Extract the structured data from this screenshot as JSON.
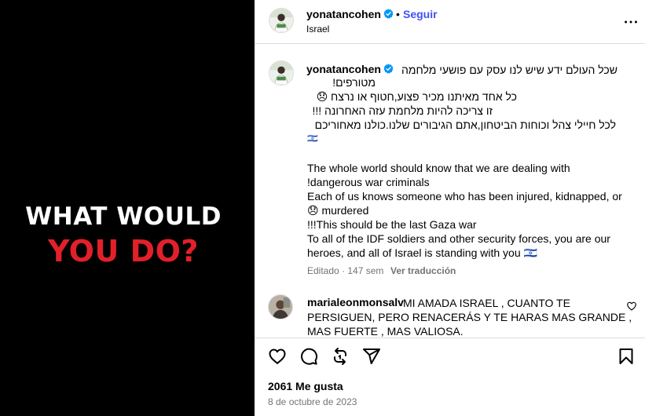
{
  "media": {
    "line1": "WHAT WOULD",
    "line2": "YOU DO?",
    "colors": {
      "background": "#000000",
      "line1": "#ffffff",
      "line2": "#e2202a"
    }
  },
  "header": {
    "username": "yonatancohen",
    "separator": "•",
    "follow_label": "Seguir",
    "location": "Israel",
    "more_icon": "more-horizontal-icon"
  },
  "caption": {
    "username": "yonatancohen",
    "lines": [
      "שכל העולם ידע שיש לנו עסק עם פושעי מלחמה",
      "מטורפים!",
      "כל אחד מאיתנו מכיר פצוע,חטוף או נרצח 😞",
      "זו צריכה להיות מלחמת עזה האחרונה !!!",
      "לכל חיילי צהל וכוחות הביטחון,אתם הגיבורים שלנו.כולנו מאחוריכם",
      "🇮🇱",
      "The whole world should know that we are dealing with",
      "!dangerous war criminals",
      "Each of us knows someone who has been injured, kidnapped, or",
      "😞 murdered",
      "!!!This should be the last Gaza war",
      "To all of the IDF soldiers and other security forces, you are our",
      "heroes, and all of Israel is standing with you 🇮🇱"
    ],
    "meta": "Editado · 147 sem",
    "translate_label": "Ver traducción"
  },
  "comment": {
    "username": "marialeonmonsalv",
    "lines": [
      "MI AMADA ISRAEL , CUANTO TE",
      "PERSIGUEN, PERO RENACERÁS Y TE HARAS MAS GRANDE ,",
      "MAS FUERTE , MAS VALIOSA."
    ],
    "like_icon": "heart-outline-icon"
  },
  "actions": {
    "icons": [
      "heart-icon",
      "comment-icon",
      "repost-icon",
      "share-icon",
      "save-icon"
    ]
  },
  "likes_label": "2061 Me gusta",
  "date_label": "8 de octubre de 2023",
  "colors": {
    "link_blue": "#4150f7",
    "muted_gray": "#737373",
    "verified_blue": "#0095f6",
    "border": "#dbdbdb"
  }
}
